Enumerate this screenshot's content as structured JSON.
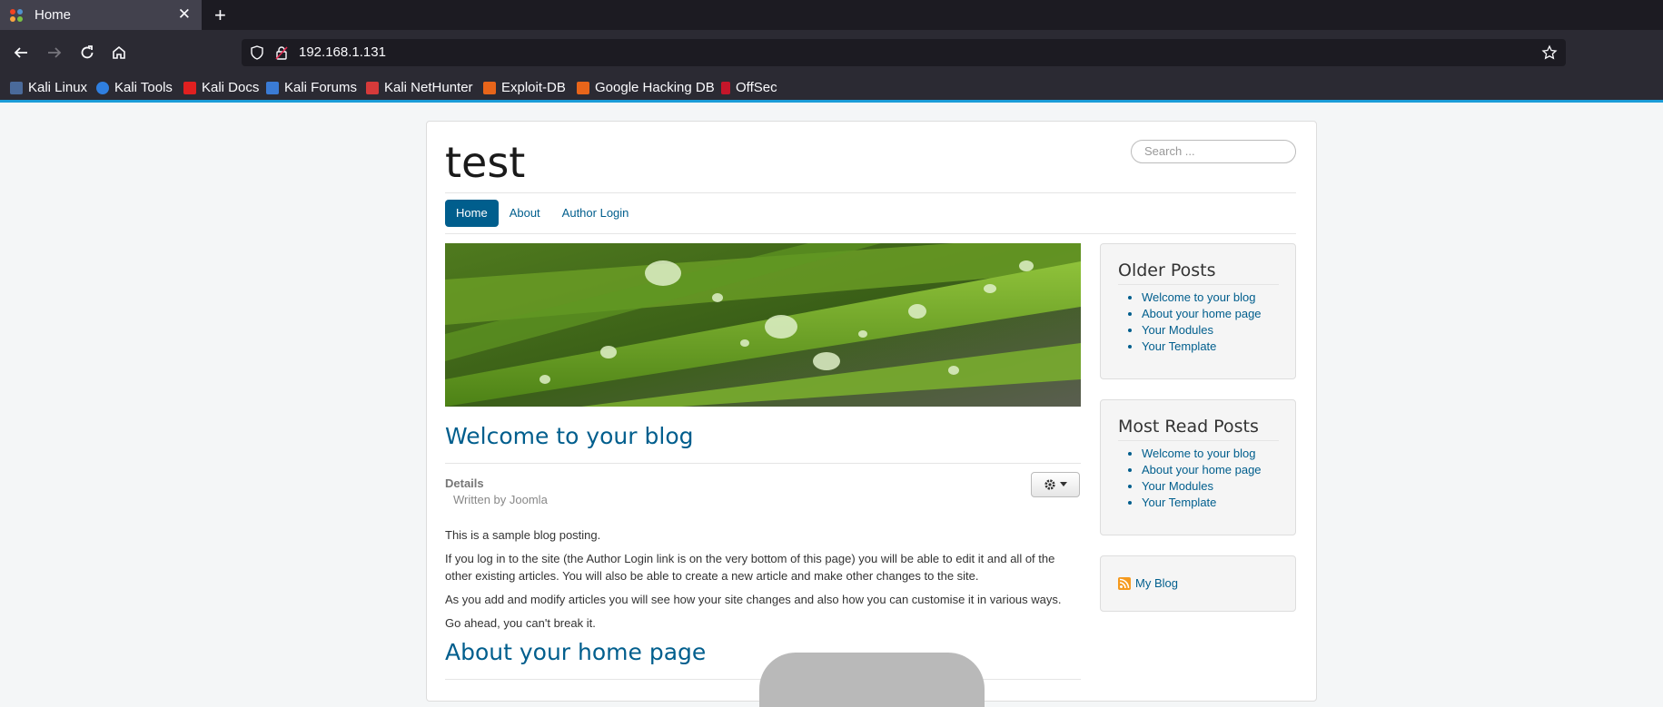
{
  "browser": {
    "tab_title": "Home",
    "url": "192.168.1.131",
    "bookmarks": [
      "Kali Linux",
      "Kali Tools",
      "Kali Docs",
      "Kali Forums",
      "Kali NetHunter",
      "Exploit-DB",
      "Google Hacking DB",
      "OffSec"
    ],
    "accent": "#1b9cd8"
  },
  "site": {
    "title": "test",
    "search_placeholder": "Search ...",
    "menu": [
      "Home",
      "About",
      "Author Login"
    ],
    "accent": "#005e8d"
  },
  "article1": {
    "title": "Welcome to your blog",
    "details_label": "Details",
    "written_by": "Written by Joomla",
    "paragraphs": [
      "This is a sample blog posting.",
      "If you log in to the site (the Author Login link is on the very bottom of this page) you will be able to edit it and all of the other existing articles. You will also be able to create a new article and make other changes to the site.",
      "As you add and modify articles you will see how your site changes and also how you can customise it in various ways.",
      "Go ahead, you can't break it."
    ]
  },
  "article2": {
    "title": "About your home page"
  },
  "sidebar": {
    "older_posts": {
      "title": "Older Posts",
      "items": [
        "Welcome to your blog",
        "About your home page",
        "Your Modules",
        "Your Template"
      ]
    },
    "most_read": {
      "title": "Most Read Posts",
      "items": [
        "Welcome to your blog",
        "About your home page",
        "Your Modules",
        "Your Template"
      ]
    },
    "feed": {
      "label": "My Blog"
    }
  }
}
